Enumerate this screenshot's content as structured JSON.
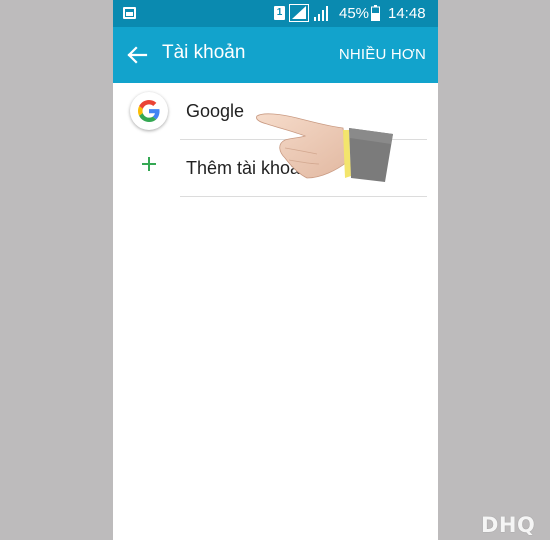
{
  "status_bar": {
    "sim": "1",
    "battery": "45%",
    "time": "14:48"
  },
  "app_bar": {
    "title": "Tài khoản",
    "more_label": "NHIỀU HƠN"
  },
  "accounts": {
    "google_label": "Google",
    "add_account_label": "Thêm tài khoản"
  },
  "colors": {
    "status_bar": "#0a8ab0",
    "app_bar": "#12a3cc",
    "add_icon": "#34a853"
  },
  "icons": {
    "back": "arrow-left-icon",
    "google": "google-logo-icon",
    "add": "plus-icon"
  },
  "watermark": "DHQ"
}
